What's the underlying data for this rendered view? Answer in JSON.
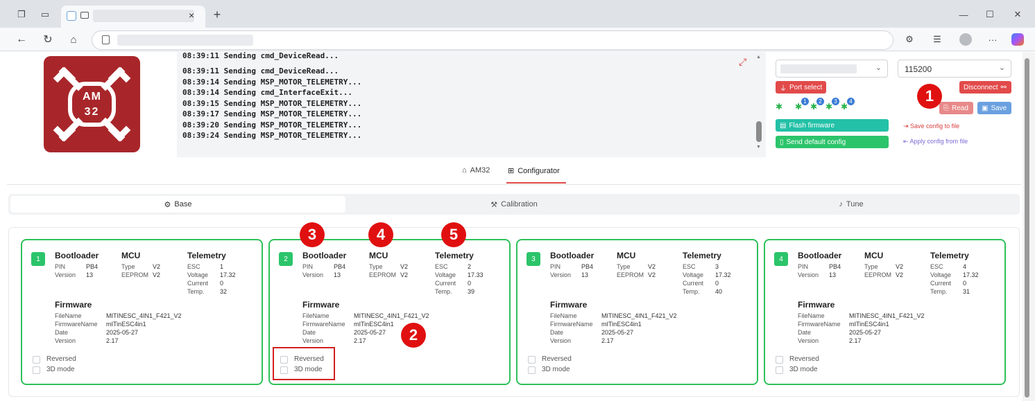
{
  "browser": {
    "tab_close": "×",
    "new_tab": "+",
    "window_controls": [
      "—",
      "☐",
      "✕"
    ]
  },
  "console": {
    "lines": [
      "08:39:11 Sending cmd_DeviceRead...",
      "08:39:11 Sending cmd_DeviceRead...",
      "08:39:14 Sending MSP_MOTOR_TELEMETRY...",
      "08:39:14 Sending cmd_InterfaceExit...",
      "08:39:15 Sending MSP_MOTOR_TELEMETRY...",
      "08:39:17 Sending MSP_MOTOR_TELEMETRY...",
      "08:39:20 Sending MSP_MOTOR_TELEMETRY...",
      "08:39:24 Sending MSP_MOTOR_TELEMETRY..."
    ]
  },
  "logo": {
    "text_top": "AM",
    "text_bottom": "32"
  },
  "controls": {
    "baud_rate": "115200",
    "port_select": "Port select",
    "disconnect": "Disconnect",
    "read": "Read",
    "save": "Save",
    "flash_firmware": "Flash firmware",
    "send_default_config": "Send default config",
    "save_config": "Save config to file",
    "apply_config": "Apply config from file",
    "bug_numbers": [
      "1",
      "2",
      "3",
      "4"
    ]
  },
  "nav": {
    "tabs": [
      "AM32",
      "Configurator"
    ],
    "subtabs": [
      "Base",
      "Calibration",
      "Tune"
    ]
  },
  "labels": {
    "bootloader": "Bootloader",
    "mcu": "MCU",
    "telemetry": "Telemetry",
    "firmware": "Firmware",
    "pin": "PIN",
    "version": "Version",
    "type": "Type",
    "eeprom": "EEPROM",
    "esc": "ESC",
    "voltage": "Voltage",
    "current": "Current",
    "temp": "Temp.",
    "filename": "FileName",
    "firmwarename": "FirmwareName",
    "date": "Date",
    "reversed": "Reversed",
    "mode3d": "3D mode"
  },
  "escs": [
    {
      "num": "1",
      "pin": "PB4",
      "bl_version": "13",
      "type": "V2",
      "eeprom": "V2",
      "esc": "1",
      "voltage": "17.32",
      "current": "0",
      "temp": "32",
      "filename": "MITINESC_4IN1_F421_V2",
      "firmwarename": "mITinESC4in1",
      "date": "2025-05-27",
      "fw_version": "2.17"
    },
    {
      "num": "2",
      "pin": "PB4",
      "bl_version": "13",
      "type": "V2",
      "eeprom": "V2",
      "esc": "2",
      "voltage": "17.33",
      "current": "0",
      "temp": "39",
      "filename": "MITINESC_4IN1_F421_V2",
      "firmwarename": "mITinESC4in1",
      "date": "2025-05-27",
      "fw_version": "2.17"
    },
    {
      "num": "3",
      "pin": "PB4",
      "bl_version": "13",
      "type": "V2",
      "eeprom": "V2",
      "esc": "3",
      "voltage": "17.32",
      "current": "0",
      "temp": "40",
      "filename": "MITINESC_4IN1_F421_V2",
      "firmwarename": "mITinESC4in1",
      "date": "2025-05-27",
      "fw_version": "2.17"
    },
    {
      "num": "4",
      "pin": "PB4",
      "bl_version": "13",
      "type": "V2",
      "eeprom": "V2",
      "esc": "4",
      "voltage": "17.32",
      "current": "0",
      "temp": "31",
      "filename": "MITINESC_4IN1_F421_V2",
      "firmwarename": "mITinESC4in1",
      "date": "2025-05-27",
      "fw_version": "2.17"
    }
  ],
  "annotations": [
    "1",
    "2",
    "3",
    "4",
    "5"
  ],
  "colors": {
    "accent_red": "#e24a4a",
    "green": "#2cc46b",
    "logo_red": "#a8262a",
    "annotation_red": "#e01010"
  }
}
